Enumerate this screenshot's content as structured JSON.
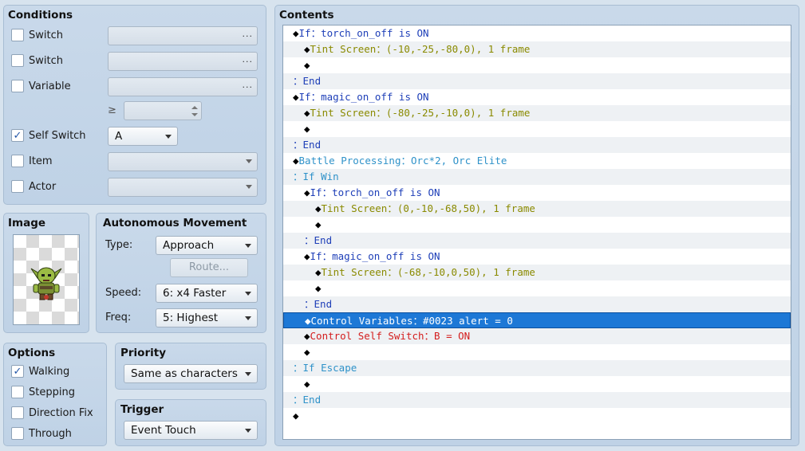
{
  "conditions": {
    "title": "Conditions",
    "switch1": {
      "label": "Switch",
      "checked": false,
      "value": ""
    },
    "switch2": {
      "label": "Switch",
      "checked": false,
      "value": ""
    },
    "variable": {
      "label": "Variable",
      "checked": false,
      "value": ""
    },
    "variable_op": "≥",
    "self_switch": {
      "label": "Self Switch",
      "checked": true,
      "value": "A"
    },
    "item": {
      "label": "Item",
      "checked": false
    },
    "actor": {
      "label": "Actor",
      "checked": false
    },
    "ellipsis": "..."
  },
  "image": {
    "title": "Image",
    "sprite": "goblin-sprite"
  },
  "movement": {
    "title": "Autonomous Movement",
    "type_label": "Type:",
    "type_value": "Approach",
    "route_label": "Route...",
    "speed_label": "Speed:",
    "speed_value": "6: x4 Faster",
    "freq_label": "Freq:",
    "freq_value": "5: Highest"
  },
  "options": {
    "title": "Options",
    "items": [
      {
        "label": "Walking",
        "checked": true
      },
      {
        "label": "Stepping",
        "checked": false
      },
      {
        "label": "Direction Fix",
        "checked": false
      },
      {
        "label": "Through",
        "checked": false
      }
    ]
  },
  "priority": {
    "title": "Priority",
    "value": "Same as characters"
  },
  "trigger": {
    "title": "Trigger",
    "value": "Event Touch"
  },
  "contents": {
    "title": "Contents",
    "lines": [
      {
        "indent": 0,
        "marker": "◆",
        "text": "If：torch_on_off is ON",
        "color": "#1e3fb8"
      },
      {
        "indent": 1,
        "marker": "◆",
        "text": "Tint Screen：(-10,-25,-80,0), 1 frame",
        "color": "#8a8a00"
      },
      {
        "indent": 1,
        "marker": "◆",
        "text": "",
        "color": "#000000"
      },
      {
        "indent": 0,
        "marker": "：",
        "text": "End",
        "color": "#1e3fb8"
      },
      {
        "indent": 0,
        "marker": "◆",
        "text": "If：magic_on_off is ON",
        "color": "#1e3fb8"
      },
      {
        "indent": 1,
        "marker": "◆",
        "text": "Tint Screen：(-80,-25,-10,0), 1 frame",
        "color": "#8a8a00"
      },
      {
        "indent": 1,
        "marker": "◆",
        "text": "",
        "color": "#000000"
      },
      {
        "indent": 0,
        "marker": "：",
        "text": "End",
        "color": "#1e3fb8"
      },
      {
        "indent": 0,
        "marker": "◆",
        "text": "Battle Processing：Orc*2, Orc Elite",
        "color": "#2f92c9"
      },
      {
        "indent": 0,
        "marker": "：",
        "text": "If Win",
        "color": "#2f92c9"
      },
      {
        "indent": 1,
        "marker": "◆",
        "text": "If：torch_on_off is ON",
        "color": "#1e3fb8"
      },
      {
        "indent": 2,
        "marker": "◆",
        "text": "Tint Screen：(0,-10,-68,50), 1 frame",
        "color": "#8a8a00"
      },
      {
        "indent": 2,
        "marker": "◆",
        "text": "",
        "color": "#000000"
      },
      {
        "indent": 1,
        "marker": "：",
        "text": "End",
        "color": "#1e3fb8"
      },
      {
        "indent": 1,
        "marker": "◆",
        "text": "If：magic_on_off is ON",
        "color": "#1e3fb8"
      },
      {
        "indent": 2,
        "marker": "◆",
        "text": "Tint Screen：(-68,-10,0,50), 1 frame",
        "color": "#8a8a00"
      },
      {
        "indent": 2,
        "marker": "◆",
        "text": "",
        "color": "#000000"
      },
      {
        "indent": 1,
        "marker": "：",
        "text": "End",
        "color": "#1e3fb8"
      },
      {
        "indent": 1,
        "marker": "◆",
        "text": "Control Variables：#0023 alert = 0",
        "color": "#ffffff",
        "selected": true
      },
      {
        "indent": 1,
        "marker": "◆",
        "text": "Control Self Switch：B = ON",
        "color": "#d41d1d"
      },
      {
        "indent": 1,
        "marker": "◆",
        "text": "",
        "color": "#000000"
      },
      {
        "indent": 0,
        "marker": "：",
        "text": "If Escape",
        "color": "#2f92c9"
      },
      {
        "indent": 1,
        "marker": "◆",
        "text": "",
        "color": "#000000"
      },
      {
        "indent": 0,
        "marker": "：",
        "text": "End",
        "color": "#2f92c9"
      },
      {
        "indent": 0,
        "marker": "◆",
        "text": "",
        "color": "#000000"
      }
    ]
  }
}
